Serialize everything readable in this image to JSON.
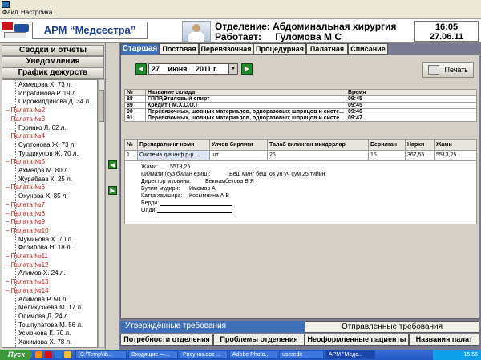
{
  "menu": {
    "file": "Файл",
    "settings": "Настройка"
  },
  "header": {
    "app_title": "АРМ “Медсестра”",
    "department_label": "Отделение: Абдоминальная хирургия",
    "worker_label": "Работает:",
    "worker_name": "Гуломова М С",
    "time": "16:05",
    "date": "27.06.11"
  },
  "sidebar": {
    "buttons": [
      "Сводки и отчёты",
      "Уведомления",
      "График дежурств"
    ],
    "tree": [
      {
        "type": "pat",
        "text": "Ахмедова Х. 73 л."
      },
      {
        "type": "pat",
        "text": "Ибрагимова Р. 19 л."
      },
      {
        "type": "pat",
        "text": "Сирожиддинова Д. 34 л."
      },
      {
        "type": "ward",
        "text": "Палата №2"
      },
      {
        "type": "ward",
        "text": "Палата №3"
      },
      {
        "type": "pat",
        "text": "Горинко Л. 62 л."
      },
      {
        "type": "ward",
        "text": "Палата №4"
      },
      {
        "type": "pat",
        "text": "Суптонова Ж. 73 л."
      },
      {
        "type": "pat",
        "text": "Турдикулов Ж. 70 л."
      },
      {
        "type": "ward",
        "text": "Палата №5"
      },
      {
        "type": "pat",
        "text": "Ахмедов М. 80 л."
      },
      {
        "type": "pat",
        "text": "Журабаев К. 25 л."
      },
      {
        "type": "ward",
        "text": "Палата №6"
      },
      {
        "type": "pat",
        "text": "Охунова Х. 85 л."
      },
      {
        "type": "ward",
        "text": "Палата №7"
      },
      {
        "type": "ward",
        "text": "Палата №8"
      },
      {
        "type": "ward",
        "text": "Палата №9"
      },
      {
        "type": "ward",
        "text": "Палата №10"
      },
      {
        "type": "pat",
        "text": "Муминова Х. 70 л."
      },
      {
        "type": "pat",
        "text": "Фозилова Н. 18 л."
      },
      {
        "type": "ward",
        "text": "Палата №11"
      },
      {
        "type": "ward",
        "text": "Палата №12"
      },
      {
        "type": "pat",
        "text": "Алимов Х. 24 л."
      },
      {
        "type": "ward",
        "text": "Палата №13"
      },
      {
        "type": "ward",
        "text": "Палата №14"
      },
      {
        "type": "pat",
        "text": "Алимова Р. 50 л."
      },
      {
        "type": "pat",
        "text": "Меликузиева М. 17 л."
      },
      {
        "type": "pat",
        "text": "Опимова Д. 24 л."
      },
      {
        "type": "pat",
        "text": "Тошпулатова М. 56 л."
      },
      {
        "type": "pat",
        "text": "Усмонова К. 70 л."
      },
      {
        "type": "pat",
        "text": "Хакимова Х. 78 л."
      }
    ]
  },
  "tabs": [
    "Старшая",
    "Постовая",
    "Перевязочная",
    "Процедурная",
    "Палатная",
    "Списание"
  ],
  "date_bar": {
    "day": "27",
    "month": "июня",
    "year": "2011 г."
  },
  "print_label": "Печать",
  "stock_table": {
    "headers": [
      "№",
      "Название склада",
      "Время"
    ],
    "rows": [
      [
        "88",
        "ГППР,Этиловый спирт",
        "09:45"
      ],
      [
        "89",
        "Кредит ( М.Х.С.О.)",
        "09:45"
      ],
      [
        "90",
        "Перевязочных, шовных материалов, одноразовых шприцов и систе...",
        "09:46"
      ],
      [
        "91",
        "Перевязочных, шовных материалов, одноразовых шприцов и систе...",
        "09:47"
      ]
    ]
  },
  "req_table": {
    "headers": [
      "№",
      "Препаратнинг номи",
      "Улчов бирлиги",
      "Талаб килинган микдорлар",
      "Берилган",
      "Нархи",
      "Жами"
    ],
    "row": [
      "1",
      "Система д/в инф р-р ...",
      "шт",
      "25",
      "15",
      "367,55",
      "5513,25"
    ]
  },
  "detail": {
    "total_label": "Жами:",
    "total_value": "5513,25",
    "sum_words_label": "Киймати (суз билан ёзиш):",
    "sum_words_value": "Беш минг беш юз ун уч сум 25 тийин",
    "director_label": "Директор муовини:",
    "director_value": "Бекмамбетова В Я",
    "head_label": "Булим мудири:",
    "head_value": "Имомов А",
    "nurse_label": "Катта хамшира:",
    "nurse_value": "Косымнина А В",
    "gave_label": "Берди:",
    "received_label": "Олди:"
  },
  "req_tabs": {
    "approved": "Утверждённые требования",
    "sent": "Отправленные требования"
  },
  "sub_tabs": [
    "Потребности отделения",
    "Проблемы отделения",
    "Неоформленные пациенты",
    "Названия палат"
  ],
  "taskbar": {
    "start": "Пуск",
    "tasks": [
      "[C:\\Temp\\lib...",
      "Входящие —...",
      "Рисунок.doc ...",
      "Adobe Photo...",
      "useredit",
      "АРМ \"Медс..."
    ],
    "clock": "15:55"
  },
  "colors": {
    "title_blue": "#1b3f9a",
    "tab_active": "#3f6fb5",
    "ward_red": "#d12020",
    "nav_green": "#1f8b2a"
  }
}
